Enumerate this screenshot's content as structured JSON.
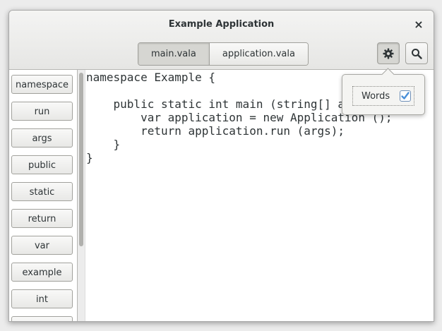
{
  "window": {
    "title": "Example Application",
    "close_glyph": "×"
  },
  "header": {
    "tabs": [
      {
        "label": "main.vala",
        "active": true
      },
      {
        "label": "application.vala",
        "active": false
      }
    ],
    "buttons": [
      {
        "icon": "gear-icon",
        "active": true
      },
      {
        "icon": "search-icon",
        "active": false
      }
    ]
  },
  "sidebar": {
    "words": [
      "namespace",
      "run",
      "args",
      "public",
      "static",
      "return",
      "var",
      "example",
      "int",
      ""
    ]
  },
  "editor": {
    "code": "namespace Example {\n\n    public static int main (string[] args) {\n        var application = new Application ();\n        return application.run (args);\n    }\n}"
  },
  "popover": {
    "option_label": "Words",
    "checked": true
  },
  "colors": {
    "accent": "#4a90d9"
  }
}
